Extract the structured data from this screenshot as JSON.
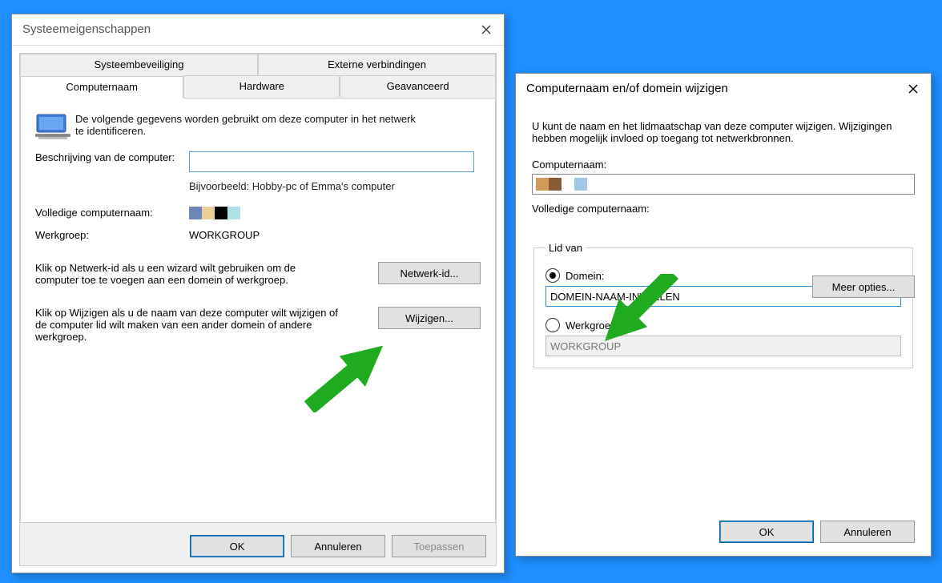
{
  "dlg1": {
    "title": "Systeemeigenschappen",
    "tabs_top": [
      "Systeembeveiliging",
      "Externe verbindingen"
    ],
    "tabs_bottom": [
      "Computernaam",
      "Hardware",
      "Geavanceerd"
    ],
    "intro": "De volgende gegevens worden gebruikt om deze computer in het netwerk te identificeren.",
    "lbl_desc": "Beschrijving van de computer:",
    "desc_value": "",
    "hint": "Bijvoorbeeld: Hobby-pc of Emma's computer",
    "lbl_full": "Volledige computernaam:",
    "lbl_wg": "Werkgroep:",
    "wg_value": "WORKGROUP",
    "netid_text": "Klik op Netwerk-id als u een wizard wilt gebruiken om de computer toe te voegen aan een domein of werkgroep.",
    "btn_netid": "Netwerk-id...",
    "change_text": "Klik op Wijzigen als u de naam van deze computer wilt wijzigen of de computer lid wilt maken van een ander domein of andere werkgroep.",
    "btn_change": "Wijzigen...",
    "btn_ok": "OK",
    "btn_cancel": "Annuleren",
    "btn_apply": "Toepassen"
  },
  "dlg2": {
    "title": "Computernaam en/of domein wijzigen",
    "para": "U kunt de naam en het lidmaatschap van deze computer wijzigen. Wijzigingen hebben mogelijk invloed op toegang tot netwerkbronnen.",
    "lbl_name": "Computernaam:",
    "lbl_full": "Volledige computernaam:",
    "btn_more": "Meer opties...",
    "legend": "Lid van",
    "opt_domain": "Domein:",
    "domain_value": "DOMEIN-NAAM-INVULLEN",
    "opt_wg": "Werkgroep:",
    "wg_value": "WORKGROUP",
    "btn_ok": "OK",
    "btn_cancel": "Annuleren"
  },
  "redact_colors": [
    "#6d86b5",
    "#e8cf9a",
    "#000000",
    "#aee0e8"
  ],
  "redact_colors2": [
    "#d09a5a",
    "#8a5a34",
    "#ffffff",
    "#9fc7e6"
  ],
  "accent": "#1fab1f"
}
